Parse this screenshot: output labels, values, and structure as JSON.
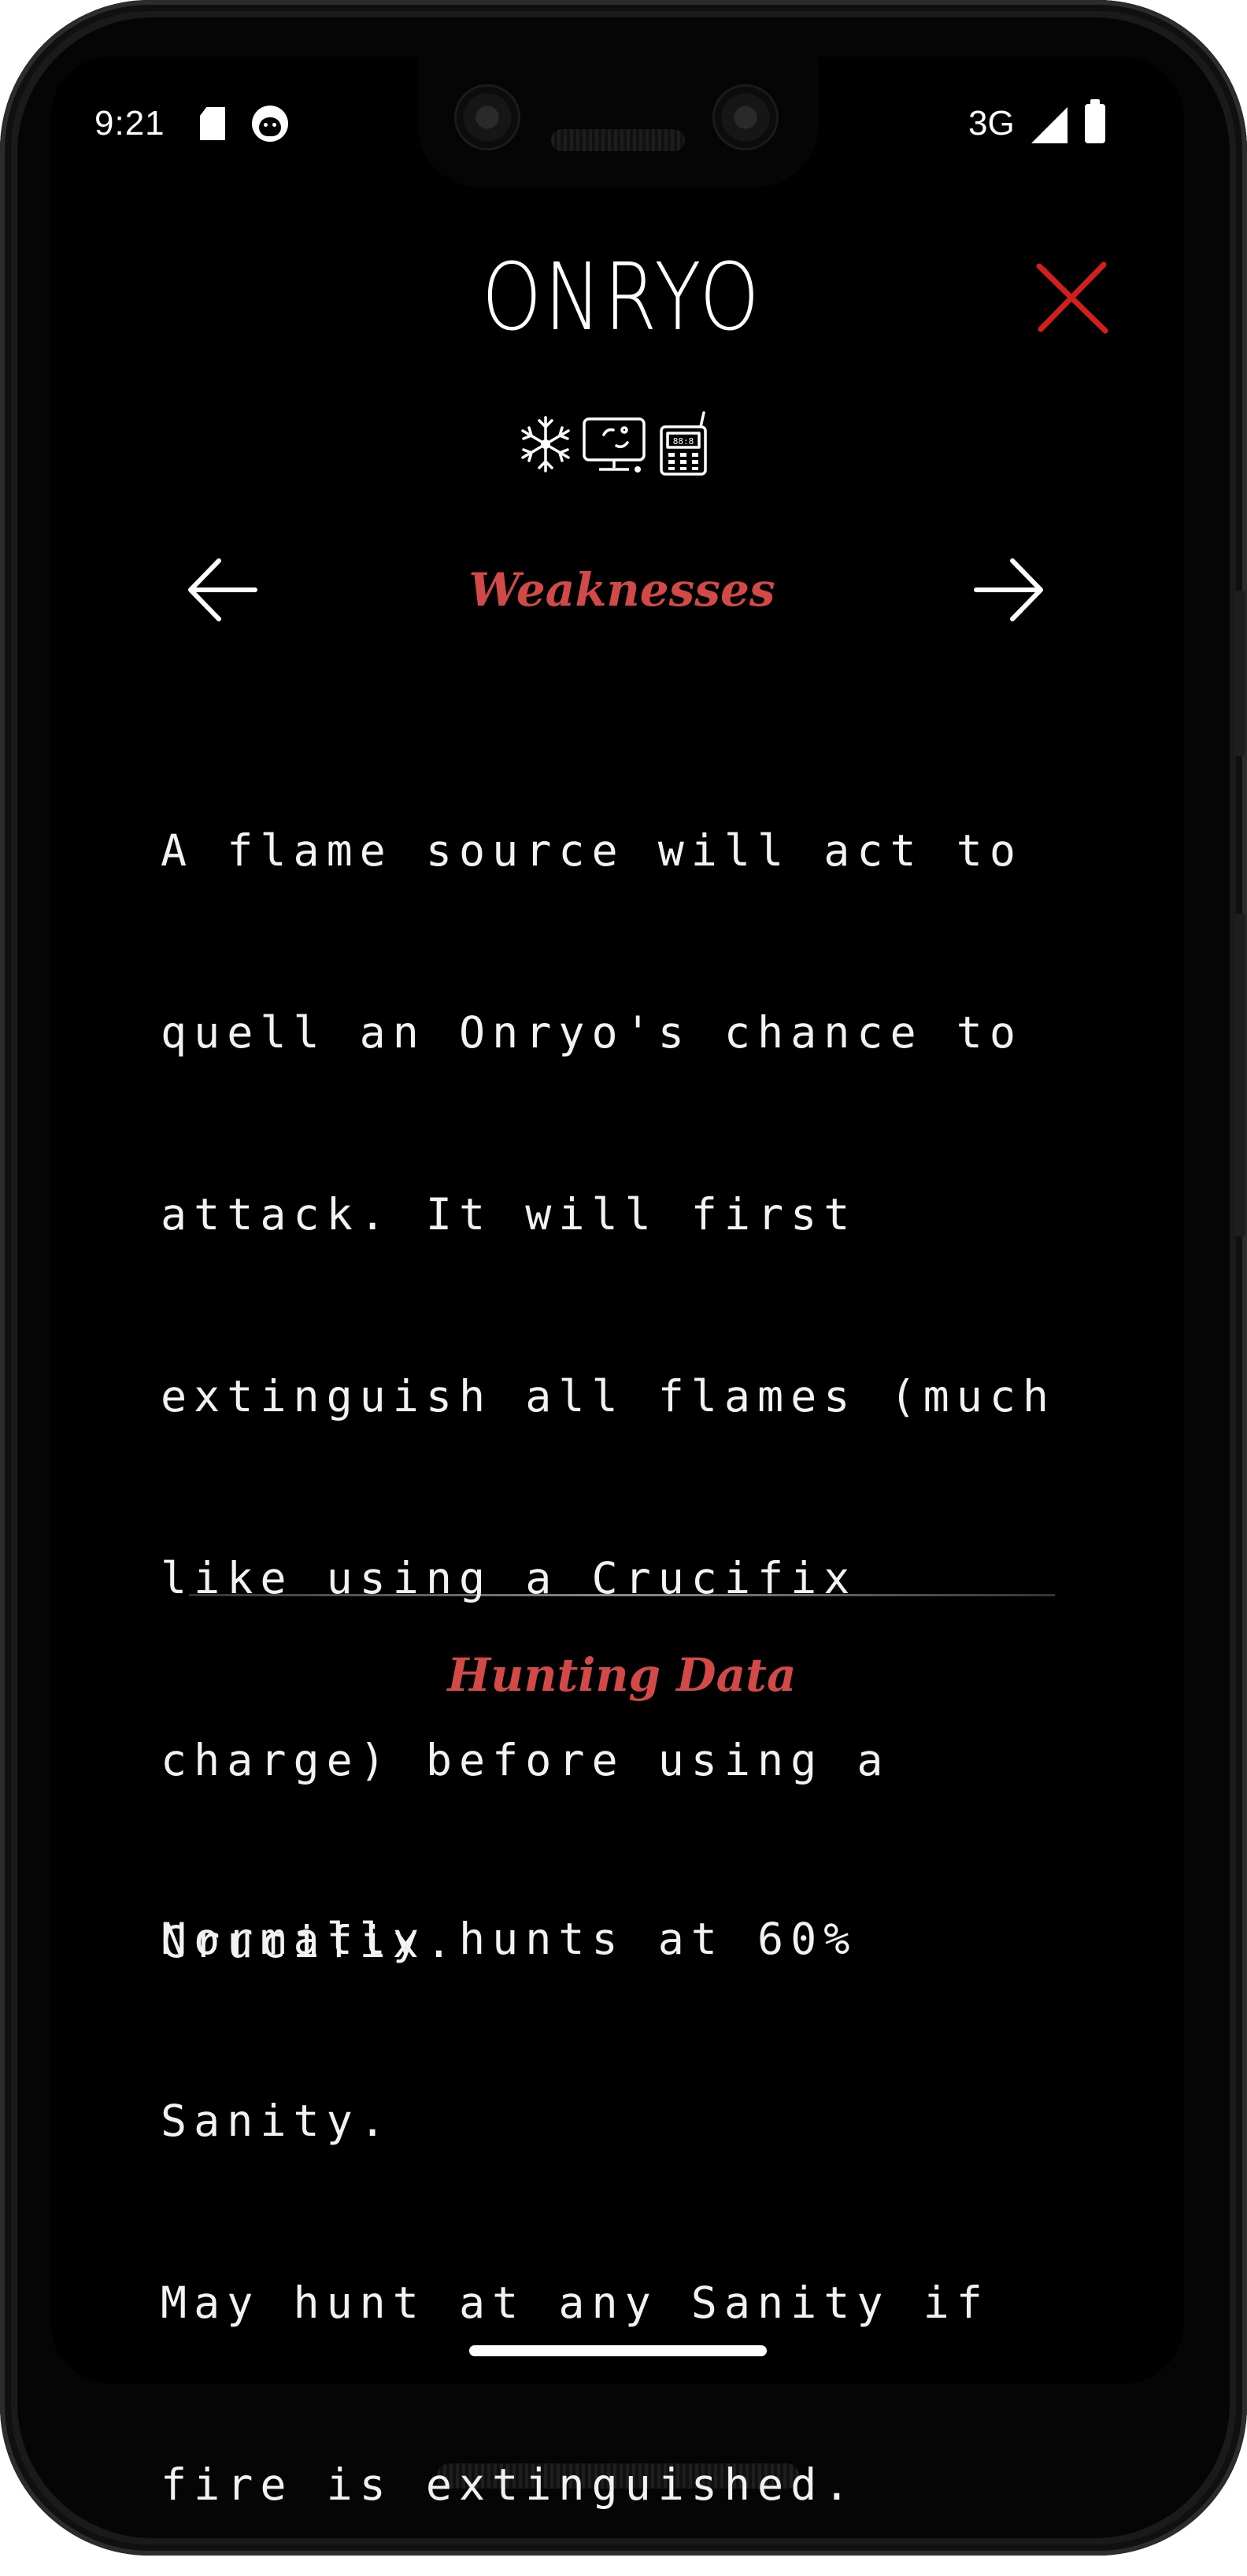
{
  "status_bar": {
    "time": "9:21",
    "network": "3G",
    "icons": [
      "sd-card-icon",
      "face-icon",
      "signal-icon",
      "battery-icon"
    ]
  },
  "ghost": {
    "name": "ONRYO",
    "evidence_icons": [
      "freezing-temperatures-icon",
      "ghost-orbs-icon",
      "spirit-box-icon"
    ]
  },
  "weaknesses": {
    "title": "Weaknesses",
    "lines": [
      "A flame source will act to",
      "quell an Onryo's chance to",
      "attack. It will first",
      "extinguish all flames (much",
      "like using a Crucifix",
      "charge) before using a",
      "Crucifix."
    ]
  },
  "hunting": {
    "title": "Hunting Data",
    "lines": [
      "Normally hunts at 60%",
      "Sanity.",
      "May hunt at any Sanity if",
      "fire is extinguished."
    ]
  },
  "nav": {
    "prev_icon": "arrow-left-icon",
    "next_icon": "arrow-right-icon",
    "close_icon": "close-icon"
  },
  "colors": {
    "accent": "#d24a48",
    "close": "#d11f1f",
    "text": "#f2f2f2",
    "background": "#000000"
  }
}
